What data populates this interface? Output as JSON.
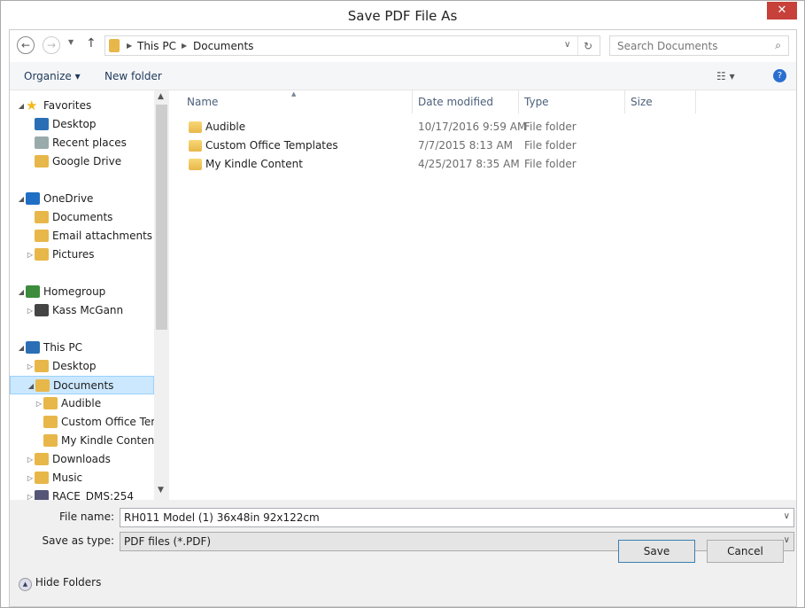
{
  "title": "Save PDF File As",
  "close": "✕",
  "address": {
    "crumbs": [
      "This PC",
      "Documents"
    ],
    "search_placeholder": "Search Documents"
  },
  "toolbar": {
    "organize": "Organize ▾",
    "new_folder": "New folder"
  },
  "nav": [
    {
      "label": "Favorites",
      "level": 0,
      "arrow": "◢",
      "icon": "star",
      "color": "#f3b81d"
    },
    {
      "label": "Desktop",
      "level": 1,
      "arrow": "",
      "icon": "desktop",
      "color": "#2a6fb5"
    },
    {
      "label": "Recent places",
      "level": 1,
      "arrow": "",
      "icon": "recent",
      "color": "#9aa"
    },
    {
      "label": "Google Drive",
      "level": 1,
      "arrow": "",
      "icon": "folder",
      "color": "#e8b74a"
    },
    {
      "label": "",
      "level": 0
    },
    {
      "label": "OneDrive",
      "level": 0,
      "arrow": "◢",
      "icon": "cloud",
      "color": "#1f6fc5"
    },
    {
      "label": "Documents",
      "level": 1,
      "arrow": "",
      "icon": "folder",
      "color": "#e8b74a"
    },
    {
      "label": "Email attachments",
      "level": 1,
      "arrow": "",
      "icon": "folder",
      "color": "#e8b74a"
    },
    {
      "label": "Pictures",
      "level": 1,
      "arrow": "▷",
      "icon": "folder",
      "color": "#e8b74a"
    },
    {
      "label": "",
      "level": 0
    },
    {
      "label": "Homegroup",
      "level": 0,
      "arrow": "◢",
      "icon": "homegroup",
      "color": "#3c8c3c"
    },
    {
      "label": "Kass McGann",
      "level": 1,
      "arrow": "▷",
      "icon": "user",
      "color": "#444"
    },
    {
      "label": "",
      "level": 0
    },
    {
      "label": "This PC",
      "level": 0,
      "arrow": "◢",
      "icon": "pc",
      "color": "#2a6fb5"
    },
    {
      "label": "Desktop",
      "level": 1,
      "arrow": "▷",
      "icon": "folder",
      "color": "#e8b74a"
    },
    {
      "label": "Documents",
      "level": 1,
      "arrow": "◢",
      "icon": "folder",
      "color": "#e8b74a",
      "selected": true
    },
    {
      "label": "Audible",
      "level": 2,
      "arrow": "▷",
      "icon": "folder",
      "color": "#e8b74a"
    },
    {
      "label": "Custom Office Tem",
      "level": 2,
      "arrow": "",
      "icon": "folder",
      "color": "#e8b74a"
    },
    {
      "label": "My Kindle Content",
      "level": 2,
      "arrow": "",
      "icon": "folder",
      "color": "#e8b74a"
    },
    {
      "label": "Downloads",
      "level": 1,
      "arrow": "▷",
      "icon": "folder",
      "color": "#e8b74a"
    },
    {
      "label": "Music",
      "level": 1,
      "arrow": "▷",
      "icon": "folder",
      "color": "#e8b74a"
    },
    {
      "label": "RACE_DMS:254",
      "level": 1,
      "arrow": "▷",
      "icon": "network",
      "color": "#557"
    }
  ],
  "columns": [
    "Name",
    "Date modified",
    "Type",
    "Size"
  ],
  "files": [
    {
      "name": "Audible",
      "date": "10/17/2016 9:59 AM",
      "type": "File folder"
    },
    {
      "name": "Custom Office Templates",
      "date": "7/7/2015 8:13 AM",
      "type": "File folder"
    },
    {
      "name": "My Kindle Content",
      "date": "4/25/2017 8:35 AM",
      "type": "File folder"
    }
  ],
  "form": {
    "file_name_label": "File name:",
    "file_name": "RH011 Model (1) 36x48in 92x122cm",
    "type_label": "Save as type:",
    "type": "PDF files (*.PDF)"
  },
  "hide_folders": "Hide Folders",
  "save": "Save",
  "cancel": "Cancel"
}
